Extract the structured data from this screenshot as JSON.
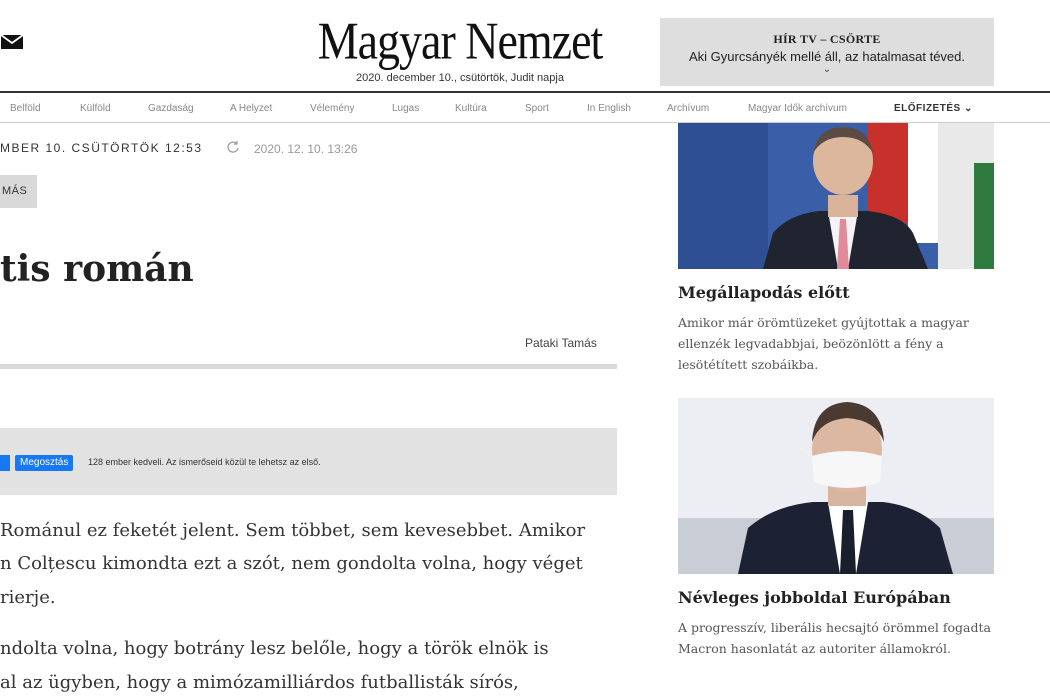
{
  "header": {
    "logo": "Magyar Nemzet",
    "date_line": "2020. december 10., csütörtök, Judit napja",
    "promo": {
      "title": "HÍR TV – CSÖRTE",
      "text": "Aki Gyurcsányék mellé áll, az hatalmasat téved."
    }
  },
  "nav": {
    "items": [
      "Belföld",
      "Külföld",
      "Gazdaság",
      "A Helyzet",
      "Vélemény",
      "Lugas",
      "Kultúra",
      "Sport",
      "In English",
      "Archívum",
      "Magyar Idők archívum"
    ],
    "subscribe": "ELŐFIZETÉS"
  },
  "article": {
    "date": "MBER 10. CSÜTÖRTÖK 12:53",
    "updated": "2020. 12. 10. 13:26",
    "tag": "MÁS",
    "headline": "tis román",
    "author": "Pataki Tamás",
    "fb": {
      "share": "Megosztás",
      "likes_text": "128 ember kedveli. Az ismerőseid közül te lehetsz az első."
    },
    "paragraphs": [
      "Románul ez feketét jelent. Sem többet, sem kevesebbet. Amikor",
      "n Colțescu kimondta ezt a szót, nem gondolta volna, hogy véget",
      "rierje.",
      "ndolta volna, hogy botrány lesz belőle, hogy a török elnök is",
      "al az ügyben, hogy a mimózamilliárdos futballisták sírós,"
    ]
  },
  "sidebar": {
    "cards": [
      {
        "title": "Megállapodás előtt",
        "lead": "Amikor már örömtüzeket gyújtottak a magyar ellenzék legvadabbjai, beözönlött a fény a lesötétített szobáikba."
      },
      {
        "title": "Névleges jobboldal Európában",
        "lead": "A progresszív, liberális hecsajtó örömmel fogadta Macron hasonlatát az autoriter államokról."
      }
    ]
  },
  "colors": {
    "accent_blue": "#1877f2",
    "gray_bar": "#e2e2e2"
  }
}
